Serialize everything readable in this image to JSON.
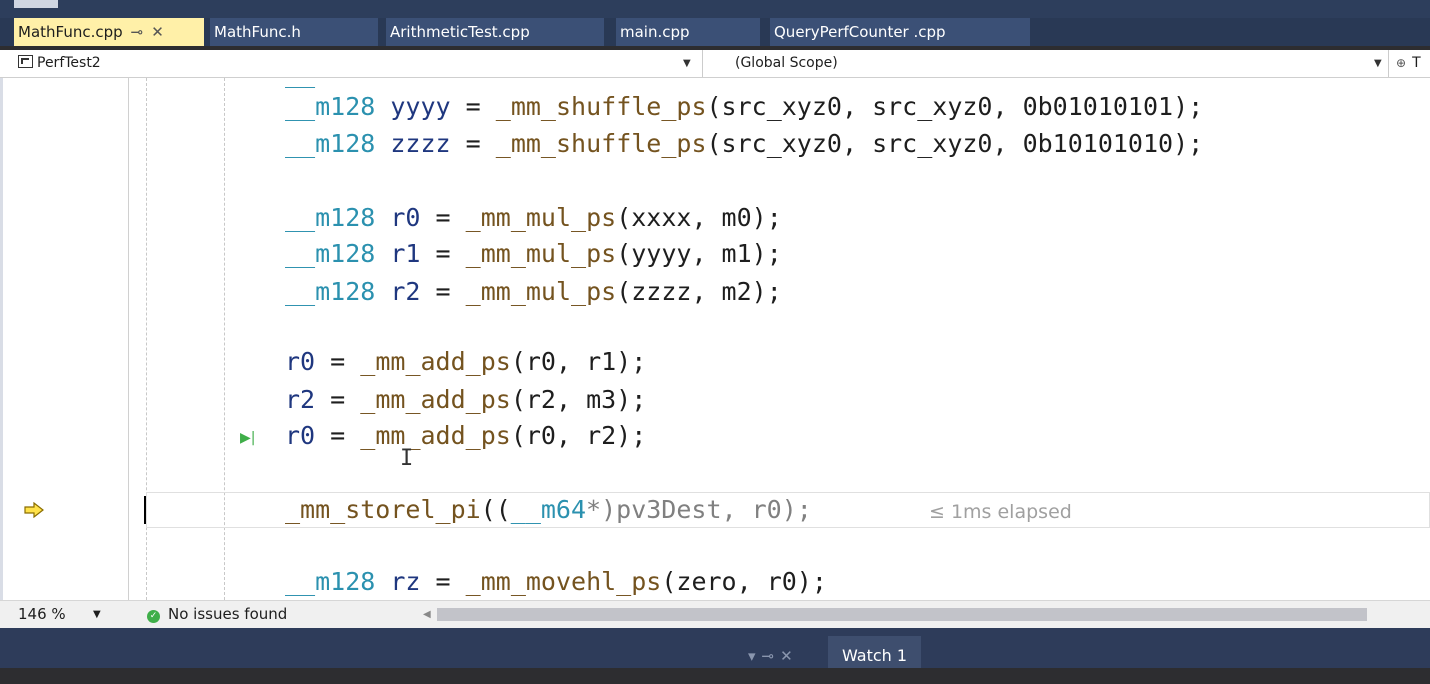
{
  "tabs": [
    {
      "label": "MathFunc.cpp",
      "active": true,
      "pinned": true
    },
    {
      "label": "MathFunc.h",
      "active": false
    },
    {
      "label": "ArithmeticTest.cpp",
      "active": false
    },
    {
      "label": "main.cpp",
      "active": false
    },
    {
      "label": "QueryPerfCounter .cpp",
      "active": false
    }
  ],
  "navbar": {
    "project": "PerfTest2",
    "scope": "(Global Scope)",
    "member_partial": "T"
  },
  "code": {
    "line1": {
      "type": "__m128",
      "name": "yyyy",
      "eq": "=",
      "fn": "_mm_shuffle_ps",
      "args": "(src_xyz0, src_xyz0, 0b01010101);"
    },
    "line2": {
      "type": "__m128",
      "name": "zzzz",
      "eq": "=",
      "fn": "_mm_shuffle_ps",
      "args": "(src_xyz0, src_xyz0, 0b10101010);"
    },
    "line3": {
      "type": "__m128",
      "name": "r0",
      "eq": "=",
      "fn": "_mm_mul_ps",
      "args": "(xxxx, m0);"
    },
    "line4": {
      "type": "__m128",
      "name": "r1",
      "eq": "=",
      "fn": "_mm_mul_ps",
      "args": "(yyyy, m1);"
    },
    "line5": {
      "type": "__m128",
      "name": "r2",
      "eq": "=",
      "fn": "_mm_mul_ps",
      "args": "(zzzz, m2);"
    },
    "line6": {
      "name": "r0",
      "eq": "=",
      "fn": "_mm_add_ps",
      "args": "(r0, r1);"
    },
    "line7": {
      "name": "r2",
      "eq": "=",
      "fn": "_mm_add_ps",
      "args": "(r2, m3);"
    },
    "line8": {
      "name": "r0",
      "eq": "=",
      "fn": "_mm_add_ps",
      "args": "(r0, r2);"
    },
    "line9": {
      "fn": "_mm_storel_pi",
      "open": "((",
      "type": "__m64",
      "rest": "*)pv3Dest, r0);"
    },
    "line10": {
      "type": "__m128",
      "name": "rz",
      "eq": "=",
      "fn": "_mm_movehl_ps",
      "args": "(zero, r0);"
    }
  },
  "perftip": "≤ 1ms elapsed",
  "status": {
    "zoom": "146 %",
    "issues": "No issues found"
  },
  "bottom": {
    "watch_tab": "Watch 1"
  },
  "colors": {
    "type": "#2b91af",
    "function": "#74531f",
    "active_tab": "#fff0a8",
    "tab_bar": "#293955"
  }
}
